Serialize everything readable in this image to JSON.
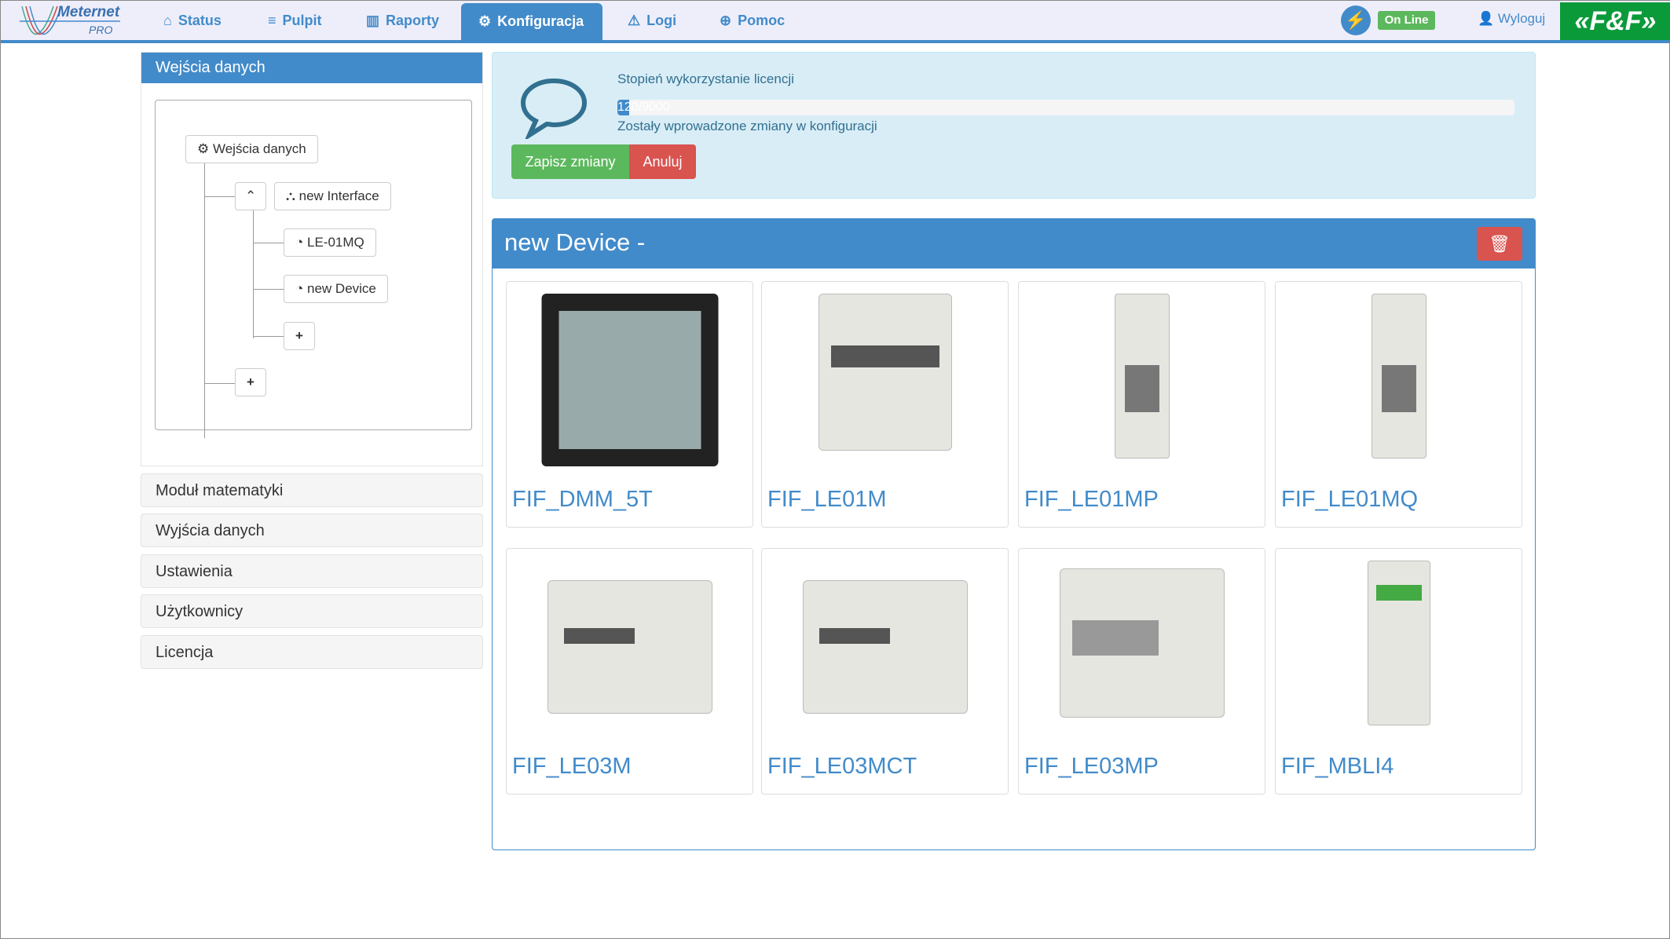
{
  "header": {
    "logo_text": "Meternet",
    "logo_sub": "PRO",
    "nav": [
      {
        "label": "Status",
        "icon": "home-icon"
      },
      {
        "label": "Pulpit",
        "icon": "list-icon"
      },
      {
        "label": "Raporty",
        "icon": "bar-chart-icon"
      },
      {
        "label": "Konfiguracja",
        "icon": "gear-icon",
        "active": true
      },
      {
        "label": "Logi",
        "icon": "warning-icon"
      },
      {
        "label": "Pomoc",
        "icon": "lifebuoy-icon"
      }
    ],
    "status": "On Line",
    "logout": "Wyloguj",
    "brand": "«F&F»"
  },
  "sidebar": {
    "title": "Wejścia danych",
    "tree": {
      "root": "Wejścia danych",
      "interface": "new Interface",
      "devices": [
        "LE-01MQ",
        "new Device"
      ],
      "add": "+"
    },
    "menu": [
      "Moduł matematyki",
      "Wyjścia danych",
      "Ustawienia",
      "Użytkownicy",
      "Licencja"
    ]
  },
  "license": {
    "label": "Stopień wykorzystanie licencji",
    "value_text": "120/9000",
    "used": 120,
    "total": 9000,
    "message": "Zostały wprowadzone zmiany w konfiguracji",
    "save": "Zapisz zmiany",
    "cancel": "Anuluj"
  },
  "device": {
    "title": "new Device -",
    "items": [
      "FIF_DMM_5T",
      "FIF_LE01M",
      "FIF_LE01MP",
      "FIF_LE01MQ",
      "FIF_LE03M",
      "FIF_LE03MCT",
      "FIF_LE03MP",
      "FIF_MBLI4"
    ]
  },
  "colors": {
    "primary": "#428bca",
    "success": "#5cb85c",
    "danger": "#d9534f",
    "brand": "#0a9a3a"
  }
}
